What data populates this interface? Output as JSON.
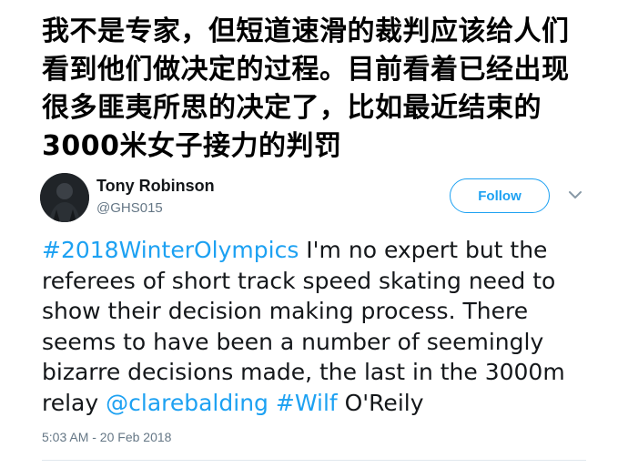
{
  "caption": {
    "lines": [
      "我不是专家，但短道速滑的裁判应该给人们",
      "看到他们做决定的过程。目前看着已经出现",
      "很多匪夷所思的决定了，比如最近结束的",
      "3000米女子接力的判罚"
    ]
  },
  "tweet": {
    "author": {
      "name": "Tony Robinson",
      "handle": "@GHS015",
      "avatar_icon": "user-avatar-photo"
    },
    "follow_label": "Follow",
    "menu_icon": "chevron-down-icon",
    "text": {
      "hashtag_main": "#2018WinterOlympics",
      "line1_rest": " I'm no expert but the",
      "line2": "referees of short track speed skating need to",
      "line3": "show their decision making process. There",
      "line4": "seems to have been a number of seemingly",
      "line5": "bizarre decisions made, the last in the 3000m",
      "line6_start": "relay ",
      "mention": "@clarebalding",
      "space": " ",
      "hashtag_wilf": "#Wilf",
      "line6_end": " O'Reily"
    },
    "timestamp": "5:03 AM - 20 Feb 2018"
  },
  "colors": {
    "link": "#1da1f2",
    "secondary_text": "#657786",
    "primary_text": "#14171a",
    "divider": "#e1e8ed"
  }
}
